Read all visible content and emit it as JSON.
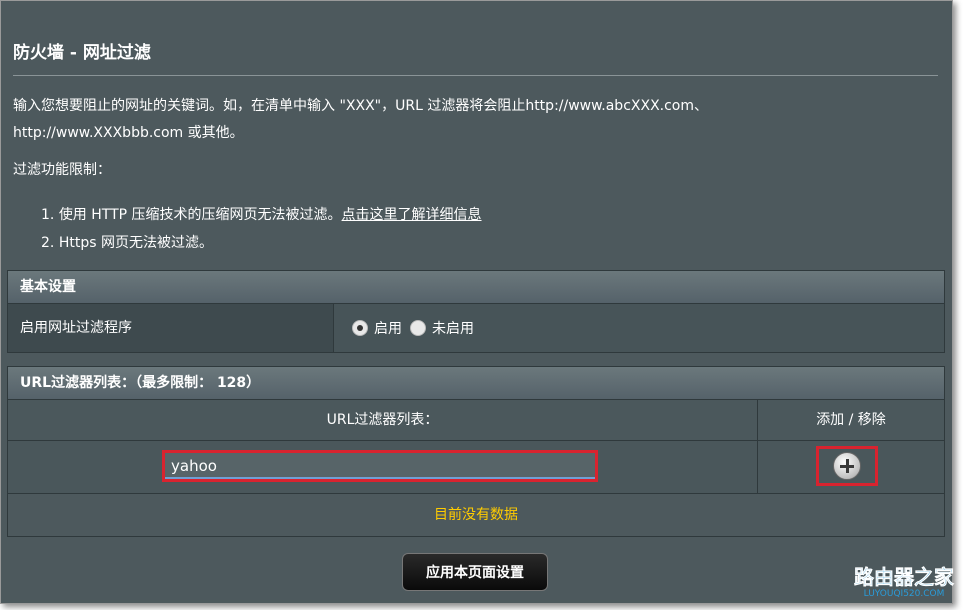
{
  "page": {
    "title": "防火墙 - 网址过滤",
    "desc_line1": "输入您想要阻止的网址的关键词。如，在清单中输入 \"XXX\"，URL 过滤器将会阻止http://www.abcXXX.com、",
    "desc_line2": "http://www.XXXbbb.com 或其他。",
    "limit_title": "过滤功能限制：",
    "limits": [
      {
        "num": "1.",
        "text": "使用 HTTP 压缩技术的压缩网页无法被过滤。",
        "link": "点击这里了解详细信息"
      },
      {
        "num": "2.",
        "text": "Https 网页无法被过滤。"
      }
    ]
  },
  "basic": {
    "header": "基本设置",
    "enable_label": "启用网址过滤程序",
    "option_on": "启用",
    "option_off": "未启用",
    "selected": "启用"
  },
  "url_list": {
    "header": "URL过滤器列表：（最多限制： 128）",
    "col_url": "URL过滤器列表：",
    "col_action": "添加 / 移除",
    "input_value": "yahoo",
    "empty_text": "目前没有数据"
  },
  "apply_button": "应用本页面设置",
  "watermark": {
    "top": "路由器之家",
    "bottom": "LUYOUQI520.COM"
  },
  "icons": {
    "add": "plus-circle-icon",
    "radio": "radio-icon"
  },
  "colors": {
    "background": "#4d595d",
    "highlight": "#d9232f",
    "empty_text": "#ffcc00"
  }
}
